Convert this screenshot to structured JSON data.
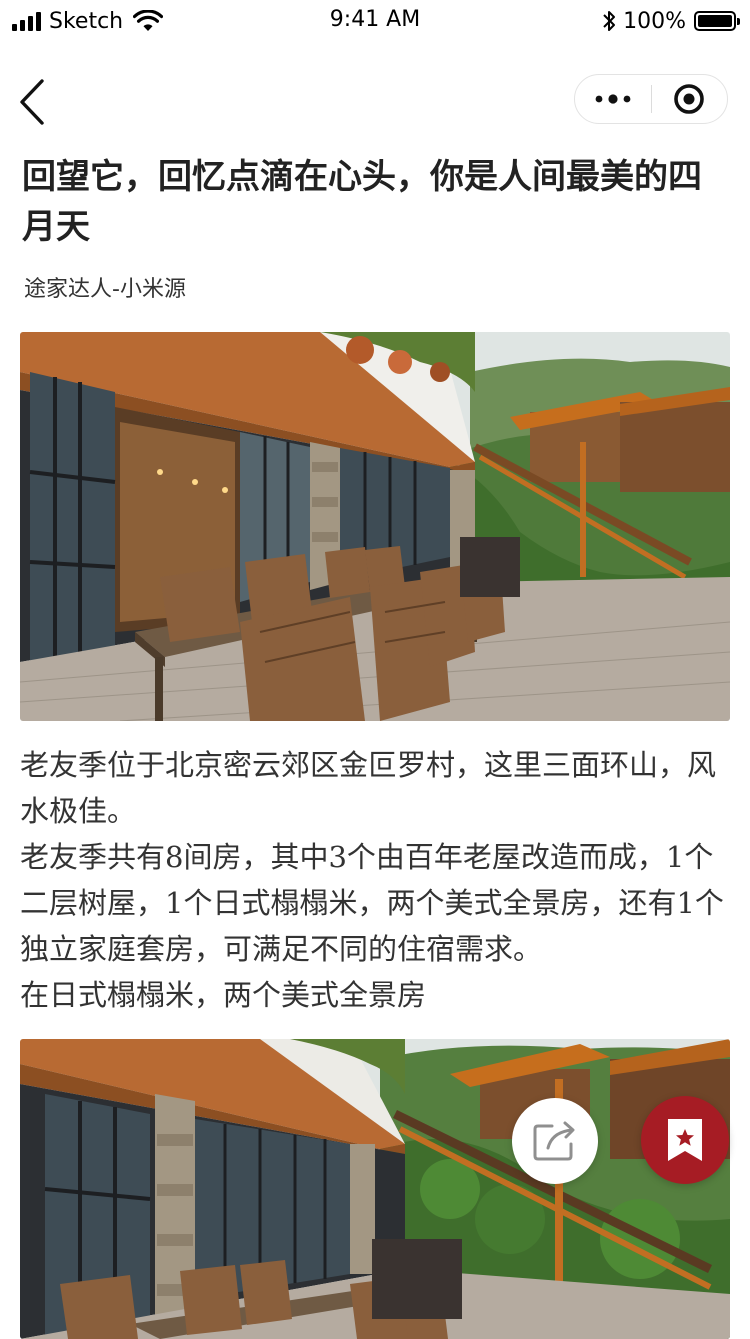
{
  "status_bar": {
    "carrier": "Sketch",
    "time": "9:41 AM",
    "battery_percent": "100%",
    "battery_level": 1.0,
    "icons": [
      "signal-icon",
      "wifi-icon",
      "bluetooth-icon",
      "battery-icon"
    ]
  },
  "nav": {
    "back_icon": "chevron-left-icon",
    "more_icon": "more-dots-icon",
    "close_icon": "target-close-icon"
  },
  "article": {
    "title": "回望它，回忆点滴在心头，你是人间最美的四月天",
    "author": "途家达人-小米源",
    "paragraphs": [
      "老友季位于北京密云郊区金叵罗村，这里三面环山，风水极佳。",
      "老友季共有8间房，其中3个由百年老屋改造而成，1个二层树屋，1个日式榻榻米，两个美式全景房，还有1个独立家庭套房，可满足不同的住宿需求。",
      "在日式榻榻米，两个美式全景房"
    ]
  },
  "floating": {
    "share_icon": "share-icon",
    "bookmark_icon": "bookmark-star-icon",
    "bookmark_color": "#a61c24"
  }
}
